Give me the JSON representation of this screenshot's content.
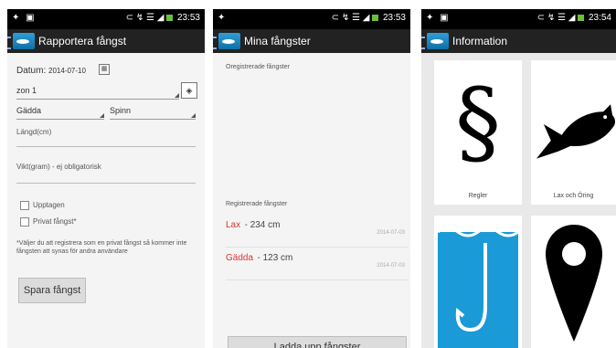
{
  "status": {
    "time1": "23:53",
    "time2": "23:53",
    "time3": "23:54",
    "battery": "58%"
  },
  "screen1": {
    "title": "Rapportera fångst",
    "date_label": "Datum:",
    "date_value": "2014-07-10",
    "zone": "zon 1",
    "species": "Gädda",
    "method": "Spinn",
    "length_label": "Längd(cm)",
    "weight_label": "Vikt(gram) - ej obligatorisk",
    "check1": "Upptagen",
    "check2": "Privat fångst*",
    "note": "*Väljer du att registrera som en privat fångst så kommer inte fångsten att synas för andra användare",
    "save_button": "Spara fångst"
  },
  "screen2": {
    "title": "Mina fångster",
    "unregistered_label": "Oregistrerade fångster",
    "registered_label": "Registrerade fångster",
    "catches": [
      {
        "species": "Lax",
        "size": "234 cm",
        "date": "2014-07-03"
      },
      {
        "species": "Gädda",
        "size": "123 cm",
        "date": "2014-07-03"
      }
    ],
    "upload_button": "Ladda upp fångster"
  },
  "screen3": {
    "title": "Information",
    "tiles": [
      {
        "label": "Regler",
        "icon": "section-sign-icon"
      },
      {
        "label": "Lax och Öring",
        "icon": "fish-icon"
      },
      {
        "label": "",
        "icon": "fishhook-icon"
      },
      {
        "label": "",
        "icon": "map-pin-icon"
      }
    ]
  },
  "colors": {
    "accent_red": "#e0342e",
    "hook_blue": "#1a9ad6",
    "bar": "#222222"
  }
}
